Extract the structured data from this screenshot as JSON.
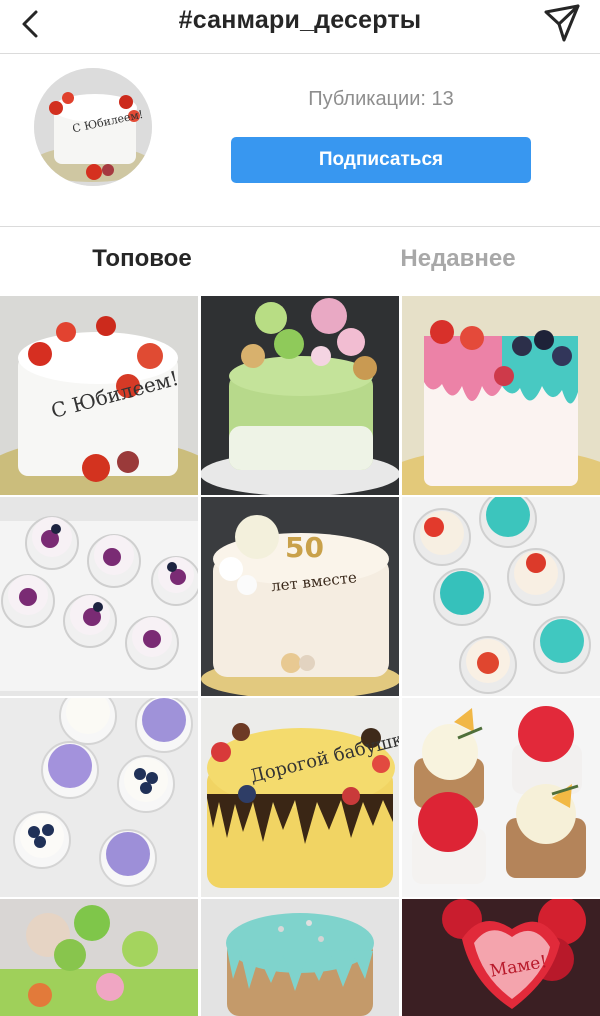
{
  "header": {
    "title": "#санмари_десерты"
  },
  "profile": {
    "posts_label": "Публикации:",
    "posts_count": "13",
    "follow_label": "Подписаться"
  },
  "tabs": {
    "top": "Топовое",
    "recent": "Недавнее"
  },
  "cake_texts": {
    "c1": "С Юбилеем!",
    "c5_num": "50",
    "c5_text": "лет вместе",
    "c8": "Дорогой бабушке",
    "c12": "Маме!"
  },
  "colors": {
    "accent": "#3897f0",
    "text": "#262626",
    "muted": "#8e8e8e",
    "divider": "#dbdbdb"
  }
}
